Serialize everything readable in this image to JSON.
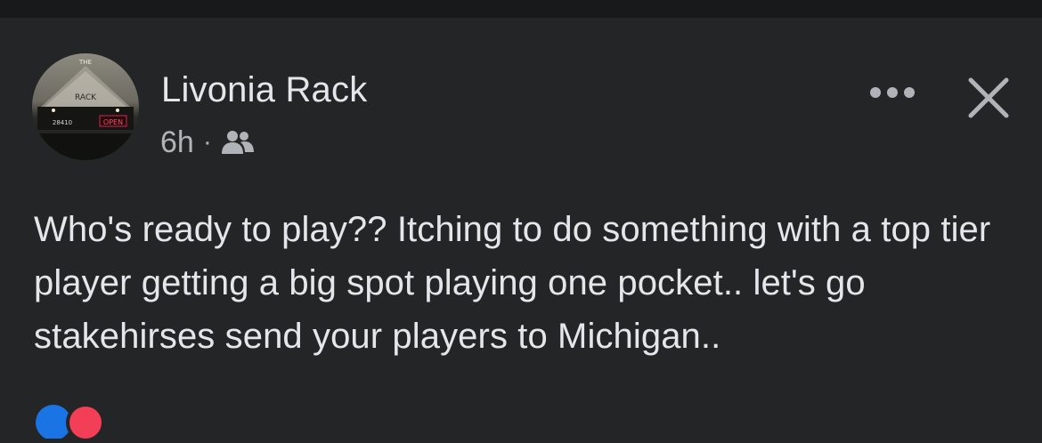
{
  "post": {
    "author": "Livonia Rack",
    "time": "6h",
    "separator": "·",
    "audience_icon": "friends-icon",
    "text": "Who's ready to play?? Itching to do something with a top tier player getting a big spot playing one pocket.. let's go stakehirses send your players to Michigan..",
    "avatar": {
      "sign_top": "THE",
      "sign_main": "RACK",
      "address": "28410",
      "open_sign": "OPEN"
    }
  },
  "actions": {
    "more_icon": "more-horizontal-icon",
    "close_icon": "close-icon"
  },
  "colors": {
    "background": "#242526",
    "text_primary": "#e4e6eb",
    "text_secondary": "#b0b3b8",
    "open_sign": "#e0244a"
  }
}
